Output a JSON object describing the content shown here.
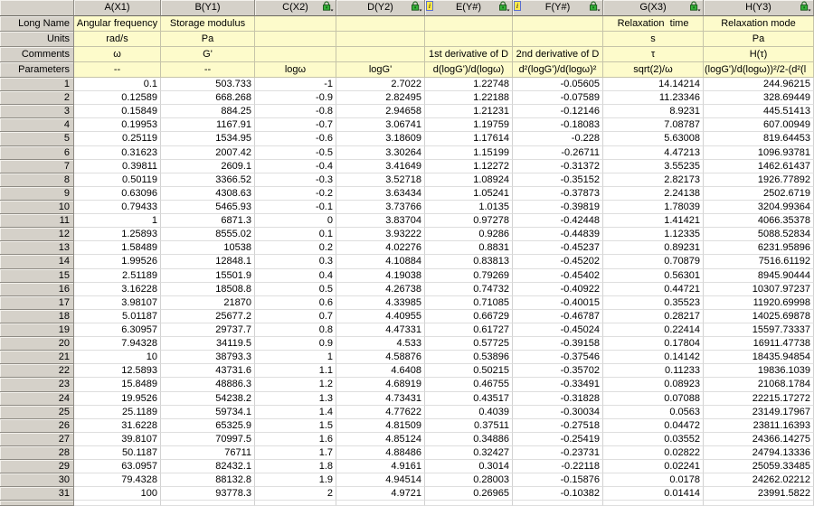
{
  "app": {
    "kind": "worksheet"
  },
  "colors": {
    "header_bg": "#d5d1c9",
    "label_bg": "#fdfbcb",
    "data_gridline": "#d2d2d2",
    "lock_green": "#35b33a",
    "info_yellow": "#ffe94f",
    "info_border_blue": "#5a6ecf"
  },
  "icons": {
    "lock": "lock-icon",
    "info": "metadata-info-icon",
    "info_glyph": "i"
  },
  "table": {
    "corner_label": "",
    "row_labels": [
      "Long Name",
      "Units",
      "Comments",
      "Parameters"
    ],
    "columns": [
      {
        "key": "A",
        "header": "A(X1)",
        "locked": false,
        "info": false,
        "long_name": "Angular frequency",
        "units": "rad/s",
        "comments": "ω",
        "parameters": "--"
      },
      {
        "key": "B",
        "header": "B(Y1)",
        "locked": false,
        "info": false,
        "long_name": "Storage modulus",
        "units": "Pa",
        "comments": "G'",
        "parameters": "--"
      },
      {
        "key": "C",
        "header": "C(X2)",
        "locked": true,
        "info": false,
        "long_name": "",
        "units": "",
        "comments": "",
        "parameters": "logω"
      },
      {
        "key": "D",
        "header": "D(Y2)",
        "locked": true,
        "info": false,
        "long_name": "",
        "units": "",
        "comments": "",
        "parameters": "logG'"
      },
      {
        "key": "E",
        "header": "E(Y#)",
        "locked": true,
        "info": true,
        "long_name": "",
        "units": "",
        "comments": "1st derivative of D",
        "parameters": "d(logG')/d(logω)"
      },
      {
        "key": "F",
        "header": "F(Y#)",
        "locked": true,
        "info": true,
        "long_name": "",
        "units": "",
        "comments": "2nd derivative of D",
        "parameters": "d²(logG')/d(logω)²"
      },
      {
        "key": "G",
        "header": "G(X3)",
        "locked": true,
        "info": false,
        "long_name": "Relaxation  time",
        "units": "s",
        "comments": "τ",
        "parameters": "sqrt(2)/ω"
      },
      {
        "key": "H",
        "header": "H(Y3)",
        "locked": true,
        "info": false,
        "long_name": "Relaxation mode",
        "units": "Pa",
        "comments": "H(τ)",
        "parameters": "(logG')/d(logω))²/2-(d²(l"
      }
    ],
    "rows": [
      [
        "1",
        "0.1",
        "503.733",
        "-1",
        "2.7022",
        "1.22748",
        "-0.05605",
        "14.14214",
        "244.96215"
      ],
      [
        "2",
        "0.12589",
        "668.268",
        "-0.9",
        "2.82495",
        "1.22188",
        "-0.07589",
        "11.23346",
        "328.69449"
      ],
      [
        "3",
        "0.15849",
        "884.25",
        "-0.8",
        "2.94658",
        "1.21231",
        "-0.12146",
        "8.9231",
        "445.51413"
      ],
      [
        "4",
        "0.19953",
        "1167.91",
        "-0.7",
        "3.06741",
        "1.19759",
        "-0.18083",
        "7.08787",
        "607.00949"
      ],
      [
        "5",
        "0.25119",
        "1534.95",
        "-0.6",
        "3.18609",
        "1.17614",
        "-0.228",
        "5.63008",
        "819.64453"
      ],
      [
        "6",
        "0.31623",
        "2007.42",
        "-0.5",
        "3.30264",
        "1.15199",
        "-0.26711",
        "4.47213",
        "1096.93781"
      ],
      [
        "7",
        "0.39811",
        "2609.1",
        "-0.4",
        "3.41649",
        "1.12272",
        "-0.31372",
        "3.55235",
        "1462.61437"
      ],
      [
        "8",
        "0.50119",
        "3366.52",
        "-0.3",
        "3.52718",
        "1.08924",
        "-0.35152",
        "2.82173",
        "1926.77892"
      ],
      [
        "9",
        "0.63096",
        "4308.63",
        "-0.2",
        "3.63434",
        "1.05241",
        "-0.37873",
        "2.24138",
        "2502.6719"
      ],
      [
        "10",
        "0.79433",
        "5465.93",
        "-0.1",
        "3.73766",
        "1.0135",
        "-0.39819",
        "1.78039",
        "3204.99364"
      ],
      [
        "11",
        "1",
        "6871.3",
        "0",
        "3.83704",
        "0.97278",
        "-0.42448",
        "1.41421",
        "4066.35378"
      ],
      [
        "12",
        "1.25893",
        "8555.02",
        "0.1",
        "3.93222",
        "0.9286",
        "-0.44839",
        "1.12335",
        "5088.52834"
      ],
      [
        "13",
        "1.58489",
        "10538",
        "0.2",
        "4.02276",
        "0.8831",
        "-0.45237",
        "0.89231",
        "6231.95896"
      ],
      [
        "14",
        "1.99526",
        "12848.1",
        "0.3",
        "4.10884",
        "0.83813",
        "-0.45202",
        "0.70879",
        "7516.61192"
      ],
      [
        "15",
        "2.51189",
        "15501.9",
        "0.4",
        "4.19038",
        "0.79269",
        "-0.45402",
        "0.56301",
        "8945.90444"
      ],
      [
        "16",
        "3.16228",
        "18508.8",
        "0.5",
        "4.26738",
        "0.74732",
        "-0.40922",
        "0.44721",
        "10307.97237"
      ],
      [
        "17",
        "3.98107",
        "21870",
        "0.6",
        "4.33985",
        "0.71085",
        "-0.40015",
        "0.35523",
        "11920.69998"
      ],
      [
        "18",
        "5.01187",
        "25677.2",
        "0.7",
        "4.40955",
        "0.66729",
        "-0.46787",
        "0.28217",
        "14025.69878"
      ],
      [
        "19",
        "6.30957",
        "29737.7",
        "0.8",
        "4.47331",
        "0.61727",
        "-0.45024",
        "0.22414",
        "15597.73337"
      ],
      [
        "20",
        "7.94328",
        "34119.5",
        "0.9",
        "4.533",
        "0.57725",
        "-0.39158",
        "0.17804",
        "16911.47738"
      ],
      [
        "21",
        "10",
        "38793.3",
        "1",
        "4.58876",
        "0.53896",
        "-0.37546",
        "0.14142",
        "18435.94854"
      ],
      [
        "22",
        "12.5893",
        "43731.6",
        "1.1",
        "4.6408",
        "0.50215",
        "-0.35702",
        "0.11233",
        "19836.1039"
      ],
      [
        "23",
        "15.8489",
        "48886.3",
        "1.2",
        "4.68919",
        "0.46755",
        "-0.33491",
        "0.08923",
        "21068.1784"
      ],
      [
        "24",
        "19.9526",
        "54238.2",
        "1.3",
        "4.73431",
        "0.43517",
        "-0.31828",
        "0.07088",
        "22215.17272"
      ],
      [
        "25",
        "25.1189",
        "59734.1",
        "1.4",
        "4.77622",
        "0.4039",
        "-0.30034",
        "0.0563",
        "23149.17967"
      ],
      [
        "26",
        "31.6228",
        "65325.9",
        "1.5",
        "4.81509",
        "0.37511",
        "-0.27518",
        "0.04472",
        "23811.16393"
      ],
      [
        "27",
        "39.8107",
        "70997.5",
        "1.6",
        "4.85124",
        "0.34886",
        "-0.25419",
        "0.03552",
        "24366.14275"
      ],
      [
        "28",
        "50.1187",
        "76711",
        "1.7",
        "4.88486",
        "0.32427",
        "-0.23731",
        "0.02822",
        "24794.13336"
      ],
      [
        "29",
        "63.0957",
        "82432.1",
        "1.8",
        "4.9161",
        "0.3014",
        "-0.22118",
        "0.02241",
        "25059.33485"
      ],
      [
        "30",
        "79.4328",
        "88132.8",
        "1.9",
        "4.94514",
        "0.28003",
        "-0.15876",
        "0.0178",
        "24262.02212"
      ],
      [
        "31",
        "100",
        "93778.3",
        "2",
        "4.9721",
        "0.26965",
        "-0.10382",
        "0.01414",
        "23991.5822"
      ]
    ]
  }
}
